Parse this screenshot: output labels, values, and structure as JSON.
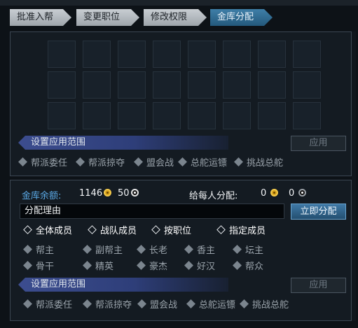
{
  "tabs": [
    {
      "label": "批准入帮",
      "active": false
    },
    {
      "label": "变更职位",
      "active": false
    },
    {
      "label": "修改权限",
      "active": false
    },
    {
      "label": "金库分配",
      "active": true
    }
  ],
  "top_section": {
    "scope_title": "设置应用范围",
    "apply_label": "应用",
    "scopes": [
      "帮派委任",
      "帮派掠夺",
      "盟会战",
      "总舵运镖",
      "挑战总舵"
    ]
  },
  "treasury": {
    "balance_label": "金库余额:",
    "gold_amount": "1146",
    "silver_amount": "50",
    "per_member_label": "给每人分配:",
    "per_member_gold": "0",
    "per_member_silver": "0",
    "reason_value": "分配理由",
    "distribute_label": "立即分配"
  },
  "target_options": [
    "全体成员",
    "战队成员",
    "按职位",
    "指定成员"
  ],
  "positions_row1": [
    "帮主",
    "副帮主",
    "长老",
    "香主",
    "坛主"
  ],
  "positions_row2": [
    "骨干",
    "精英",
    "豪杰",
    "好汉",
    "帮众"
  ],
  "bottom_section": {
    "scope_title": "设置应用范围",
    "apply_label": "应用",
    "scopes": [
      "帮派委任",
      "帮派掠夺",
      "盟会战",
      "总舵运镖",
      "挑战总舵"
    ]
  },
  "colors": {
    "accent_blue": "#5aa9e6",
    "tab_active": "#2f6c94",
    "ribbon": "#3c4d8f",
    "gold_coin": "#f2c94c"
  }
}
